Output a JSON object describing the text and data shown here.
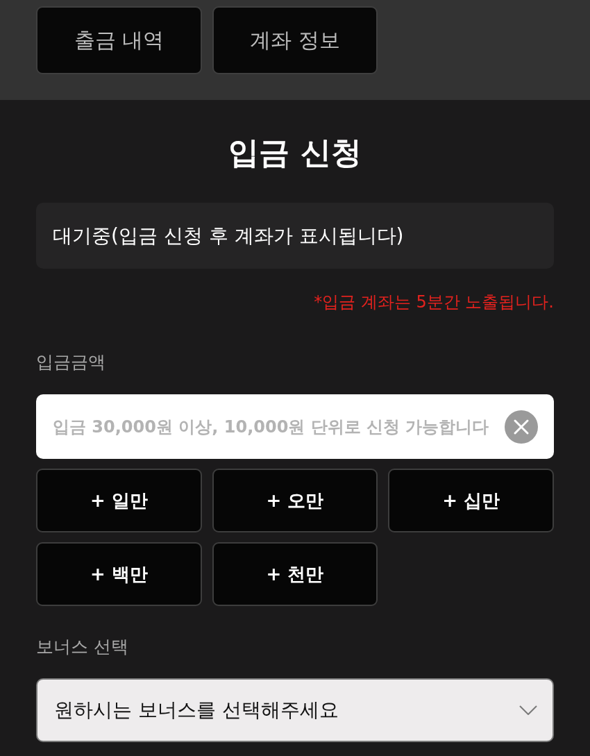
{
  "nav_buttons": [
    {
      "label": "출금 내역"
    },
    {
      "label": "계좌 정보"
    }
  ],
  "title": "입금 신청",
  "account_status": "대기중(입금 신청 후 계좌가 표시됩니다)",
  "notice": "*입금 계좌는 5분간 노출됩니다.",
  "amount": {
    "label": "입금금액",
    "placeholder": "입금 30,000원 이상, 10,000원 단위로 신청 가능합니다",
    "quick_buttons": [
      "+ 일만",
      "+ 오만",
      "+ 십만",
      "+ 백만",
      "+ 천만"
    ]
  },
  "bonus": {
    "label": "보너스 선택",
    "placeholder": "원하시는 보너스를 선택해주세요"
  }
}
